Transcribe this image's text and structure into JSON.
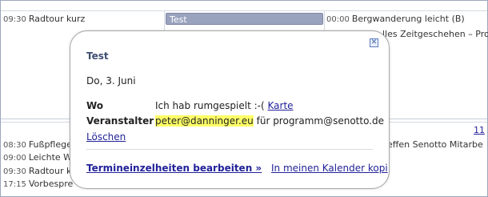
{
  "calendar": {
    "top_row": {
      "left_event": {
        "time": "09:30",
        "title": "Radtour kurz"
      },
      "bar_event": {
        "title": "Test"
      },
      "right_event": {
        "time": "00:00",
        "title": "Bergwanderung leicht (B)"
      },
      "right_event_2": {
        "title": "lles Zeitgeschehen – Pro"
      }
    },
    "day_number": "11",
    "bottom_row": {
      "events": [
        {
          "time": "08:30",
          "title": "Fußpflege"
        },
        {
          "time": "09:00",
          "title": "Leichte W"
        },
        {
          "time": "09:30",
          "title": "Radtour k"
        },
        {
          "time": "17:15",
          "title": "Vorbespre"
        }
      ],
      "right_event": {
        "title": "effen Senotto Mitarbe"
      }
    }
  },
  "popup": {
    "close_glyph": "✕",
    "title": "Test",
    "date": "Do, 3. Juni",
    "where_label": "Wo",
    "where_text": "Ich hab rumgespielt :-(",
    "map_link": "Karte",
    "organizer_label": "Veranstalter",
    "organizer_email": "peter@danninger.eu",
    "organizer_suffix": "für programm@senotto.de",
    "delete_link": "Löschen",
    "edit_link": "Termineinzelheiten bearbeiten »",
    "copy_link": "In meinen Kalender kopi"
  }
}
